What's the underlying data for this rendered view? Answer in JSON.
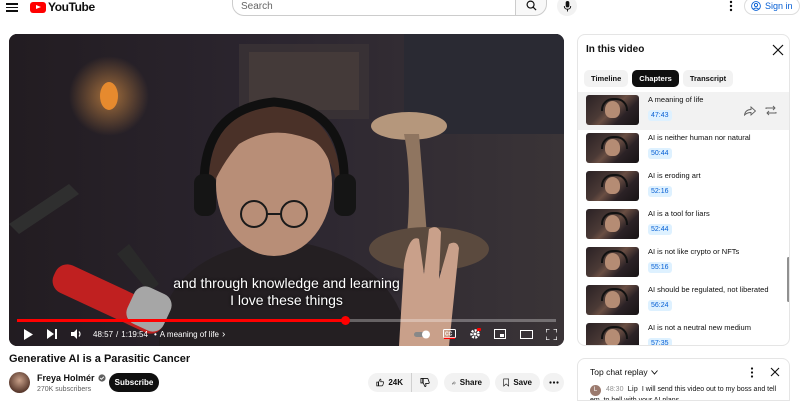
{
  "header": {
    "logo_text": "YouTube",
    "search_placeholder": "Search",
    "sign_in_label": "Sign in"
  },
  "player": {
    "caption_line1": "and through knowledge and learning",
    "caption_line2": "I love these things",
    "time_current": "48:57",
    "time_total": "1:19:54",
    "time_separator": "/",
    "current_chapter": "A meaning of life",
    "progress": 0.61
  },
  "video": {
    "title": "Generative AI is a Parasitic Cancer",
    "channel": "Freya Holmér",
    "subscribers": "270K subscribers",
    "subscribe_label": "Subscribe",
    "likes": "24K",
    "share_label": "Share",
    "save_label": "Save"
  },
  "panel": {
    "title": "In this video",
    "tabs": [
      {
        "label": "Timeline",
        "active": false
      },
      {
        "label": "Chapters",
        "active": true
      },
      {
        "label": "Transcript",
        "active": false
      }
    ],
    "chapters": [
      {
        "title": "A meaning of life",
        "time": "47:43",
        "active": true
      },
      {
        "title": "AI is neither human nor natural",
        "time": "50:44",
        "active": false
      },
      {
        "title": "AI is eroding art",
        "time": "52:16",
        "active": false
      },
      {
        "title": "AI is a tool for liars",
        "time": "52:44",
        "active": false
      },
      {
        "title": "AI is not like crypto or NFTs",
        "time": "55:16",
        "active": false
      },
      {
        "title": "AI should be regulated, not liberated",
        "time": "56:24",
        "active": false
      },
      {
        "title": "AI is not a neutral new medium",
        "time": "57:35",
        "active": false
      }
    ]
  },
  "chat": {
    "header": "Top chat replay",
    "message": {
      "time": "48:30",
      "author": "Lip",
      "avatar_letter": "L",
      "text": "I will send this video out to my boss and tell em, to hell with your AI plans"
    }
  },
  "colors": {
    "brand_red": "#ff0000",
    "link_blue": "#065fd4"
  }
}
